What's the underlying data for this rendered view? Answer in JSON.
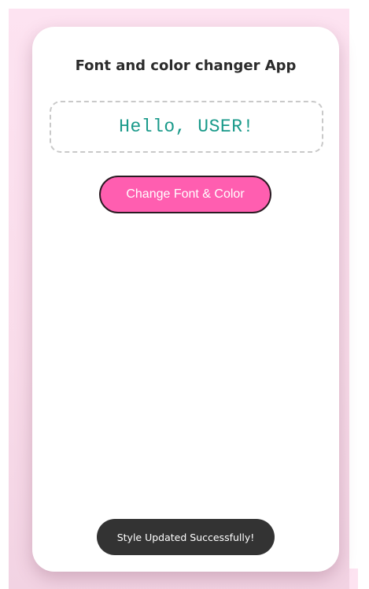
{
  "app": {
    "title": "Font and color changer App"
  },
  "greeting": {
    "text": "Hello, USER!",
    "color": "#1a9a8a"
  },
  "controls": {
    "change_button_label": "Change Font & Color",
    "button_color": "#ff5eb0"
  },
  "toast": {
    "message": "Style Updated Successfully!"
  },
  "theme": {
    "background": "#fde3f1",
    "card": "#ffffff"
  }
}
